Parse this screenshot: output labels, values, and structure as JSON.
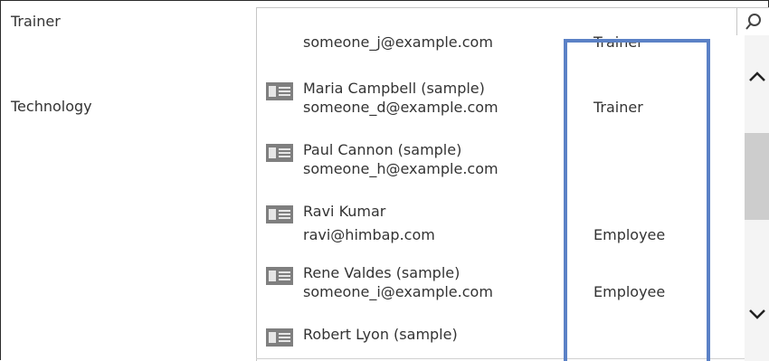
{
  "form": {
    "trainer_label": "Trainer",
    "technology_label": "Technology"
  },
  "lookup": {
    "search_icon": "search-icon",
    "rows": [
      {
        "name": "",
        "email": "someone_j@example.com",
        "role": "Trainer"
      },
      {
        "name": "Maria Campbell (sample)",
        "email": "someone_d@example.com",
        "role": "Trainer"
      },
      {
        "name": "Paul Cannon (sample)",
        "email": "someone_h@example.com",
        "role": ""
      },
      {
        "name": "Ravi Kumar",
        "email": "ravi@himbap.com",
        "role": "Employee"
      },
      {
        "name": "Rene Valdes (sample)",
        "email": "someone_i@example.com",
        "role": "Employee"
      },
      {
        "name": "Robert Lyon (sample)",
        "email": "",
        "role": ""
      }
    ]
  },
  "colors": {
    "highlight": "#5b81c6",
    "thumb": "#cdcdcd"
  }
}
